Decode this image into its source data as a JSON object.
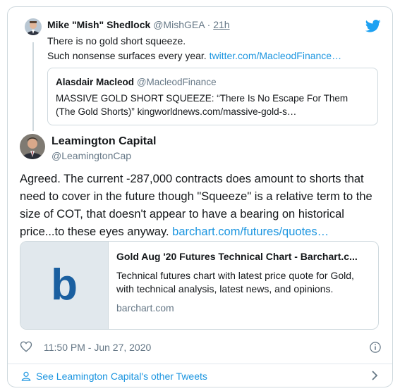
{
  "reply": {
    "name": "Mike \"Mish\" Shedlock",
    "handle": "@MishGEA",
    "separator": "·",
    "time": "21h",
    "text_line1": "There is no gold short squeeze.",
    "text_line2": "Such nonsense surfaces every year.",
    "link": "twitter.com/MacleodFinance…"
  },
  "quoted": {
    "name": "Alasdair Macleod",
    "handle": "@MacleodFinance",
    "text": "MASSIVE GOLD SHORT SQUEEZE: “There Is No Escape For Them (The Gold Shorts)”",
    "link": "kingworldnews.com/massive-gold-s…"
  },
  "main": {
    "name": "Leamington Capital",
    "handle": "@LeamingtonCap",
    "text": "Agreed. The current -287,000 contracts does amount to shorts that need to cover in the future though \"Squeeze\" is a relative term to the size of COT, that doesn't appear to have a bearing on historical price...to these eyes anyway.",
    "link": "barchart.com/futures/quotes…"
  },
  "link_card": {
    "title": "Gold Aug '20 Futures Technical Chart - Barchart.c...",
    "description": "Technical futures chart with latest price quote for Gold, with technical analysis, latest news, and opinions.",
    "domain": "barchart.com",
    "logo_letter": "b"
  },
  "footer": {
    "timestamp": "11:50 PM - Jun 27, 2020",
    "see_more": "See Leamington Capital's other Tweets"
  },
  "colors": {
    "link": "#1b95e0",
    "muted": "#657786",
    "barchart_blue": "#1a5fa0",
    "twitter_blue": "#1da1f2"
  },
  "icons": {
    "brand": "twitter-bird-icon",
    "like": "heart-icon",
    "info": "info-icon",
    "profile": "person-icon",
    "more": "chevron-right-icon"
  }
}
